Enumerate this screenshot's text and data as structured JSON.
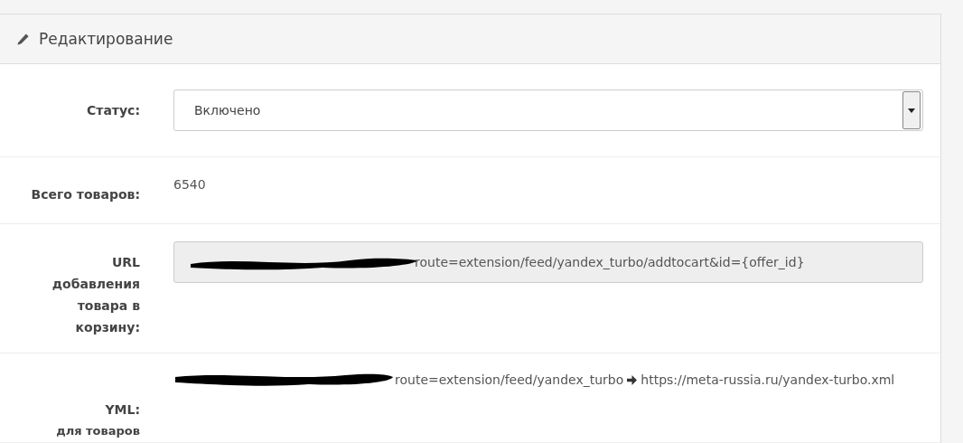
{
  "panel": {
    "title": "Редактирование"
  },
  "status": {
    "label": "Статус:",
    "value": "Включено"
  },
  "total": {
    "label": "Всего товаров:",
    "value": "6540"
  },
  "cart_url": {
    "label": "URL добавления товара в корзину:",
    "value": "route=extension/feed/yandex_turbo/addtocart&id={offer_id}",
    "disabled": true
  },
  "yml": {
    "label": "YML:",
    "sublabel": "для товаров",
    "source": "route=extension/feed/yandex_turbo",
    "target": "https://meta-russia.ru/yandex-turbo.xml"
  }
}
